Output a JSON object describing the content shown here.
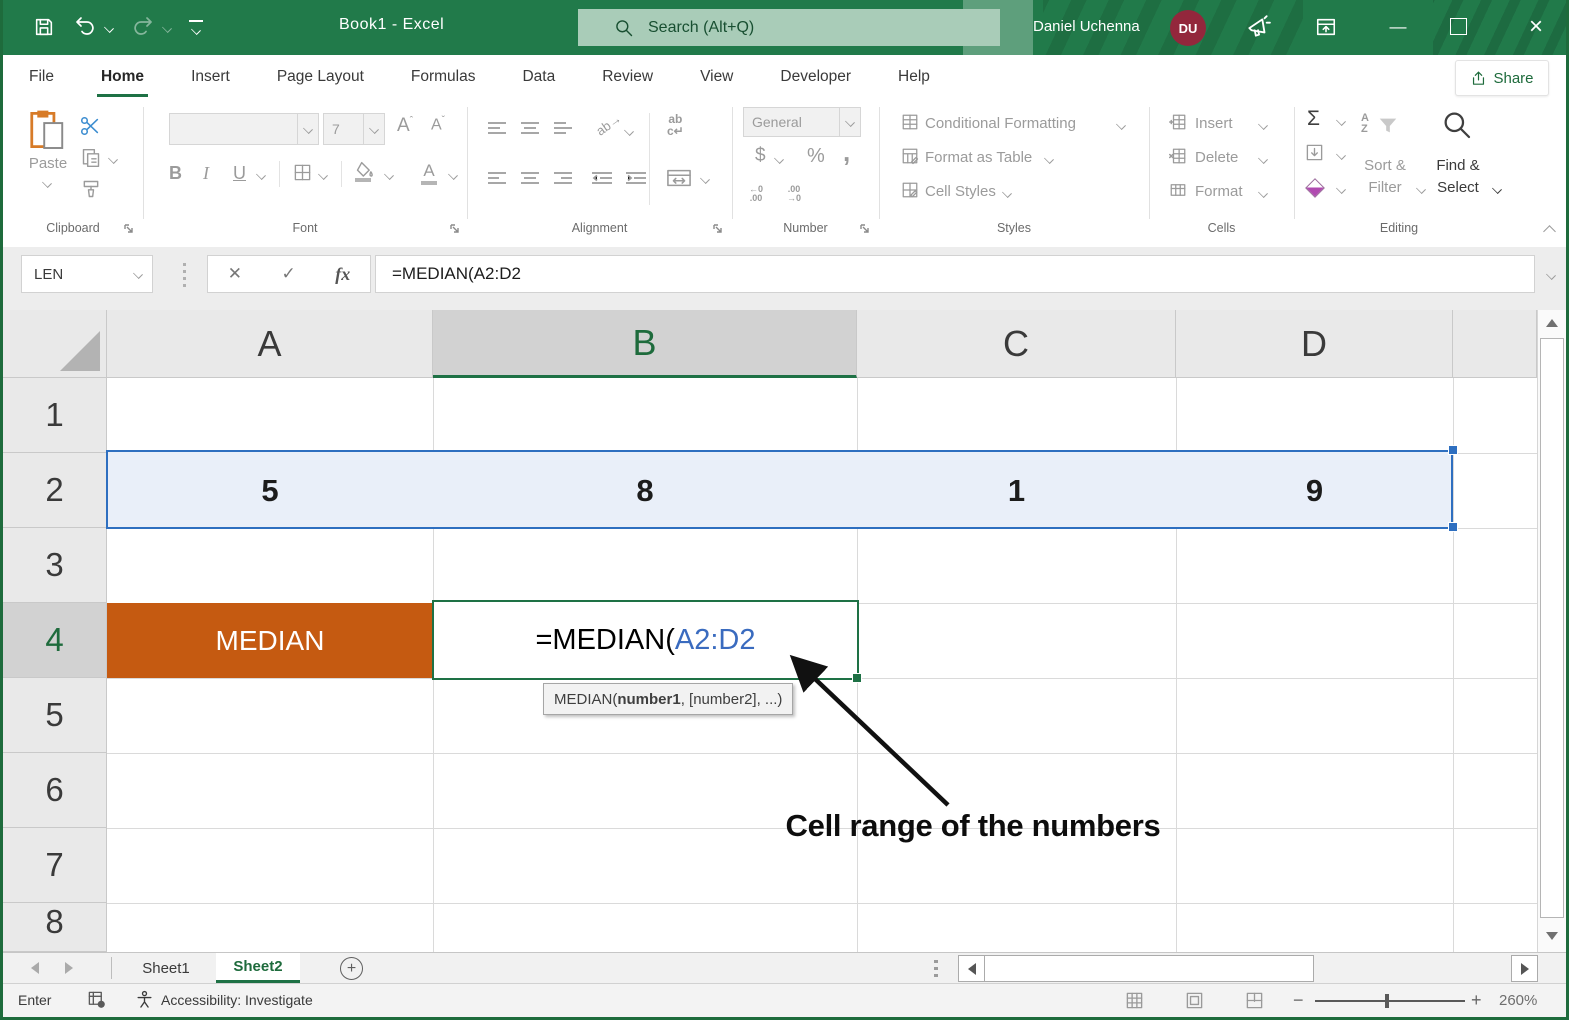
{
  "colors": {
    "excel_green": "#217A4A",
    "window_border_green": "#1E6B3C",
    "accent_orange": "#C55A11",
    "selection_blue": "#2E6FC0",
    "formula_reference_blue": "#3A6BBF",
    "avatar_maroon": "#93273C"
  },
  "title_bar": {
    "title": "Book1 - Excel",
    "search_placeholder": "Search (Alt+Q)",
    "user_name": "Daniel Uchenna",
    "user_initials": "DU"
  },
  "tabs": [
    {
      "label": "File"
    },
    {
      "label": "Home"
    },
    {
      "label": "Insert"
    },
    {
      "label": "Page Layout"
    },
    {
      "label": "Formulas"
    },
    {
      "label": "Data"
    },
    {
      "label": "Review"
    },
    {
      "label": "View"
    },
    {
      "label": "Developer"
    },
    {
      "label": "Help"
    }
  ],
  "share_label": "Share",
  "ribbon": {
    "clipboard": {
      "group_label": "Clipboard",
      "paste_label": "Paste"
    },
    "font": {
      "group_label": "Font",
      "size_value": "7",
      "bold_label": "B",
      "italic_label": "I",
      "underline_label": "U"
    },
    "alignment": {
      "group_label": "Alignment"
    },
    "number": {
      "group_label": "Number",
      "format_value": "General",
      "currency_label": "$",
      "percent_label": "%",
      "comma_label": ","
    },
    "styles": {
      "group_label": "Styles",
      "items": [
        {
          "label": "Conditional Formatting"
        },
        {
          "label": "Format as Table"
        },
        {
          "label": "Cell Styles"
        }
      ]
    },
    "cells": {
      "group_label": "Cells",
      "items": [
        {
          "label": "Insert"
        },
        {
          "label": "Delete"
        },
        {
          "label": "Format"
        }
      ]
    },
    "editing": {
      "group_label": "Editing",
      "autosum_label": "Σ",
      "sort_filter_line1": "Sort &",
      "sort_filter_line2": "Filter",
      "find_select_line1": "Find &",
      "find_select_line2": "Select"
    }
  },
  "formula_bar": {
    "name_box_value": "LEN",
    "fx_label": "fx",
    "formula": "=MEDIAN(A2:D2"
  },
  "sheet": {
    "col_headers": [
      {
        "label": "A"
      },
      {
        "label": "B"
      },
      {
        "label": "C"
      },
      {
        "label": "D"
      }
    ],
    "row_headers": [
      {
        "label": "1"
      },
      {
        "label": "2"
      },
      {
        "label": "3"
      },
      {
        "label": "4"
      },
      {
        "label": "5"
      },
      {
        "label": "6"
      },
      {
        "label": "7"
      },
      {
        "label": "8"
      }
    ],
    "row2": [
      {
        "cell": "A2",
        "value": "5"
      },
      {
        "cell": "B2",
        "value": "8"
      },
      {
        "cell": "C2",
        "value": "1"
      },
      {
        "cell": "D2",
        "value": "9"
      }
    ],
    "a4_value": "MEDIAN",
    "b4_formula_prefix": "=MEDIAN(",
    "b4_formula_reference": "A2:D2"
  },
  "formula_tooltip": {
    "prefix": "MEDIAN(",
    "bold_argument": "number1",
    "suffix": ", [number2], ...)"
  },
  "annotation_label": "Cell range of the numbers",
  "sheet_tabs": [
    {
      "label": "Sheet1"
    },
    {
      "label": "Sheet2"
    }
  ],
  "status_bar": {
    "mode": "Enter",
    "accessibility_label": "Accessibility: Investigate",
    "zoom_percent": "260%"
  }
}
